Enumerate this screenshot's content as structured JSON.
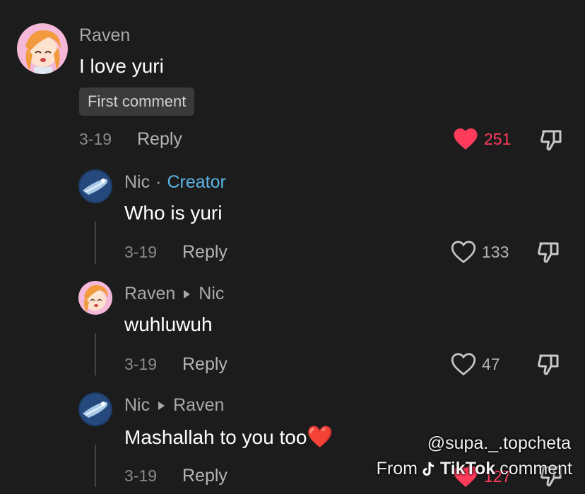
{
  "comments": [
    {
      "author": "Raven",
      "text": "I love yuri",
      "badge": "First comment",
      "date": "3-19",
      "reply_label": "Reply",
      "likes": "251",
      "liked": true
    },
    {
      "author": "Nic",
      "separator": "·",
      "role": "Creator",
      "text": "Who is yuri",
      "date": "3-19",
      "reply_label": "Reply",
      "likes": "133",
      "liked": false
    },
    {
      "author": "Raven",
      "reply_to": "Nic",
      "text": "wuhluwuh",
      "date": "3-19",
      "reply_label": "Reply",
      "likes": "47",
      "liked": false
    },
    {
      "author": "Nic",
      "reply_to": "Raven",
      "text": "Mashallah to you too",
      "emoji": "❤️",
      "date": "3-19",
      "reply_label": "Reply",
      "likes": "127",
      "liked": true
    }
  ],
  "watermark": {
    "handle": "@supa._.topcheta",
    "from": "From",
    "brand": "TikTok",
    "suffix": "comment"
  },
  "colors": {
    "background": "#1c1c1c",
    "liked": "#ff3b5c",
    "creator": "#5cb4e4"
  },
  "icons": [
    "heart-filled-icon",
    "heart-outline-icon",
    "dislike-icon",
    "tiktok-note-icon"
  ]
}
